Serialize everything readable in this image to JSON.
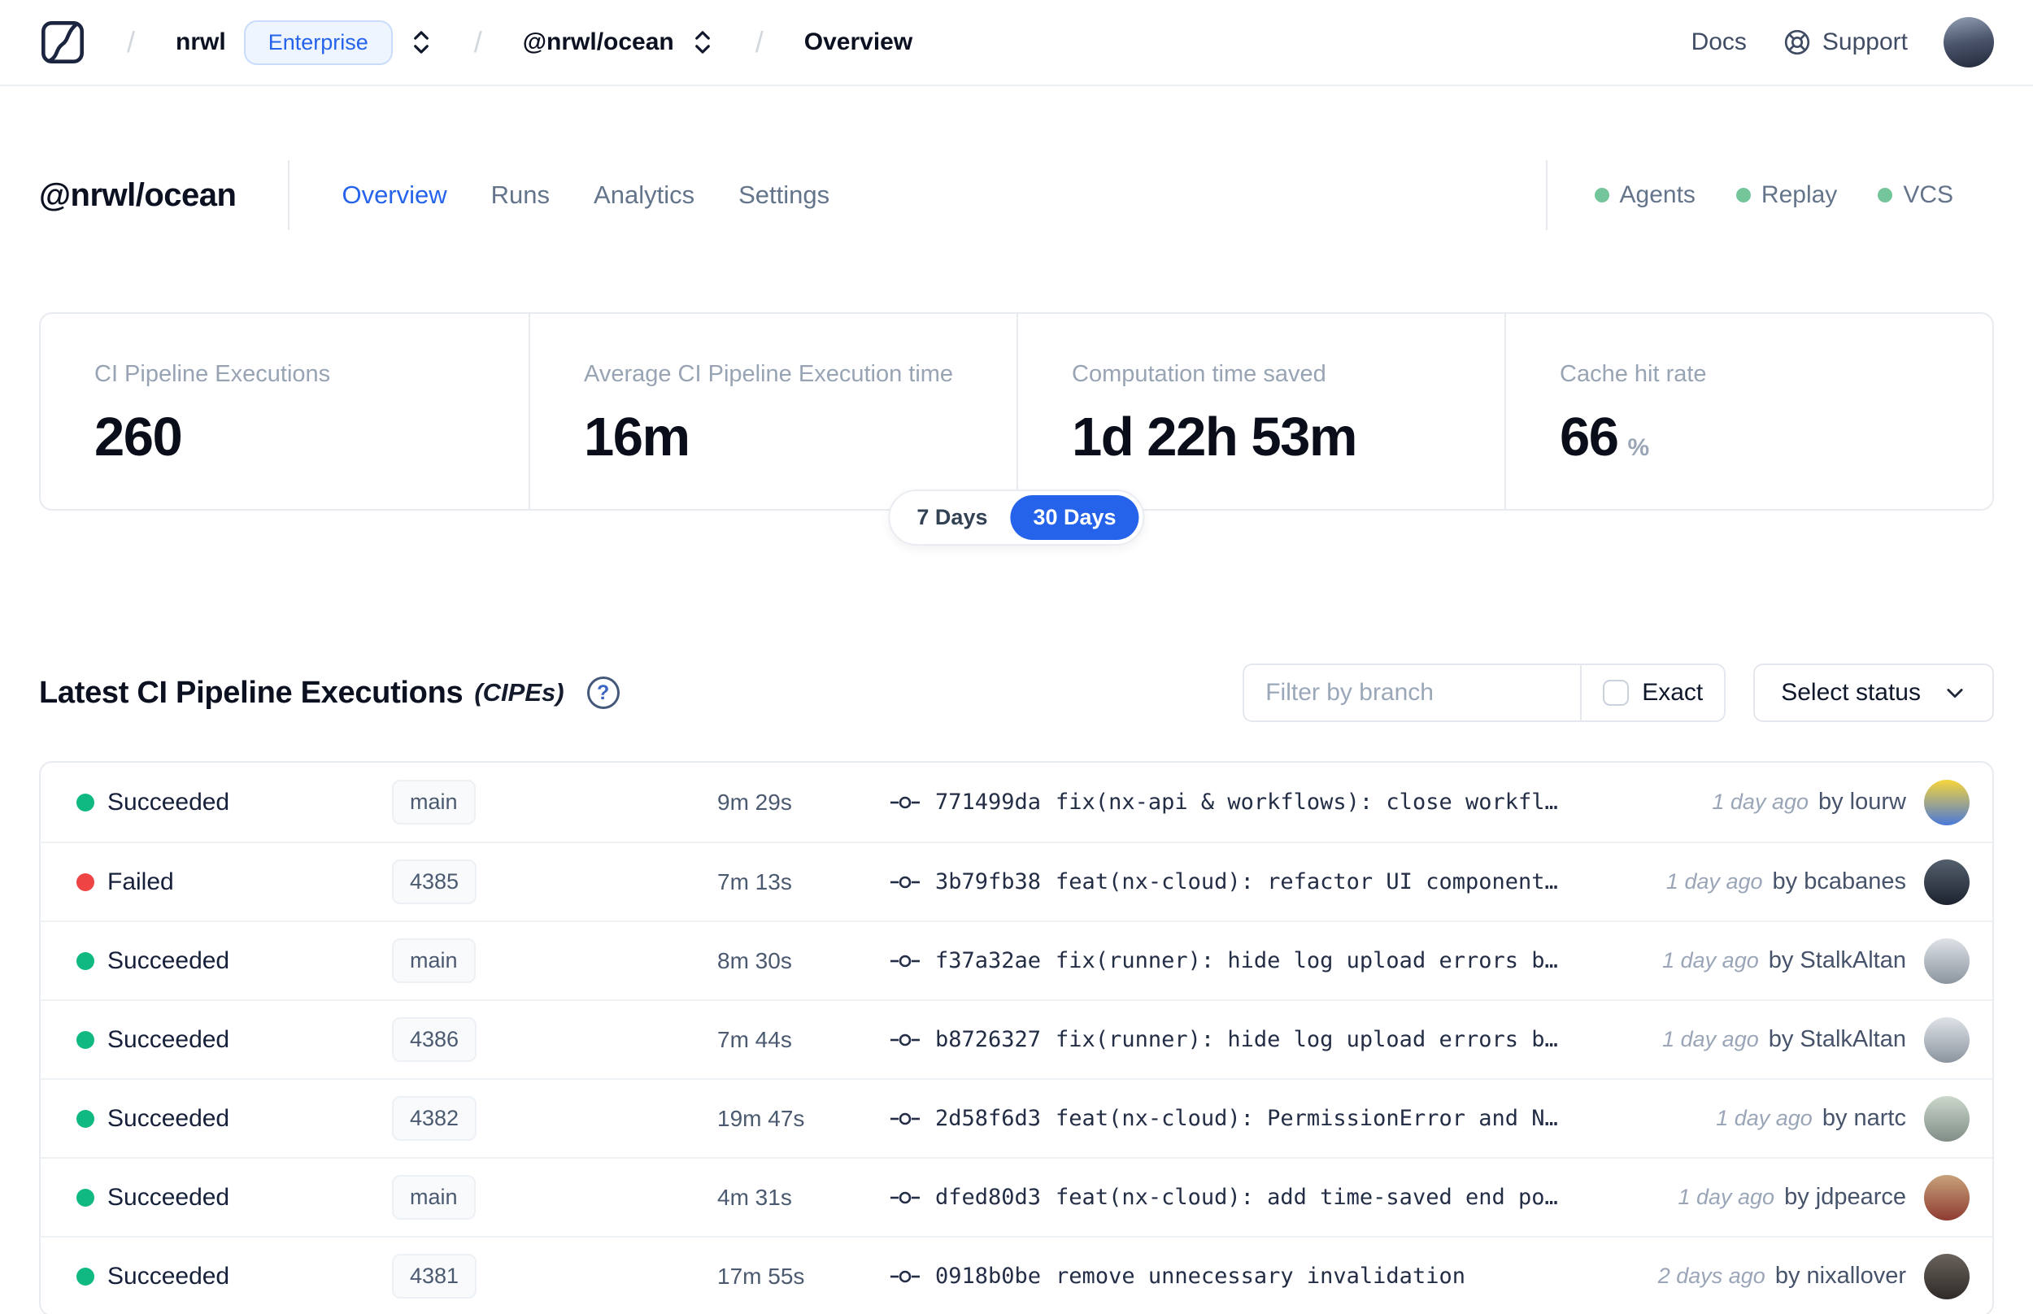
{
  "colors": {
    "accent": "#2563eb",
    "success": "#10b981",
    "failure": "#ef4444",
    "indicator_green": "#74c69a"
  },
  "icons": {
    "help": "?"
  },
  "navbar": {
    "separator": "/",
    "org": "nrwl",
    "org_badge": "Enterprise",
    "workspace": "@nrwl/ocean",
    "page": "Overview",
    "docs": "Docs",
    "support": "Support"
  },
  "header": {
    "title": "@nrwl/ocean",
    "tabs": [
      {
        "label": "Overview",
        "active": true
      },
      {
        "label": "Runs",
        "active": false
      },
      {
        "label": "Analytics",
        "active": false
      },
      {
        "label": "Settings",
        "active": false
      }
    ],
    "indicators": [
      {
        "label": "Agents"
      },
      {
        "label": "Replay"
      },
      {
        "label": "VCS"
      }
    ]
  },
  "stats": [
    {
      "label": "CI Pipeline Executions",
      "value": "260",
      "suffix": ""
    },
    {
      "label": "Average CI Pipeline Execution time",
      "value": "16m",
      "suffix": ""
    },
    {
      "label": "Computation time saved",
      "value": "1d 22h 53m",
      "suffix": ""
    },
    {
      "label": "Cache hit rate",
      "value": "66",
      "suffix": "%"
    }
  ],
  "range_toggle": [
    {
      "label": "7 Days",
      "active": false
    },
    {
      "label": "30 Days",
      "active": true
    }
  ],
  "section": {
    "title": "Latest CI Pipeline Executions",
    "subtitle": "(CIPEs)"
  },
  "filters": {
    "branch_placeholder": "Filter by branch",
    "exact_label": "Exact",
    "status_label": "Select status"
  },
  "table": {
    "rows": [
      {
        "status": "Succeeded",
        "branch": "main",
        "duration": "9m 29s",
        "hash": "771499da",
        "message": "fix(nx-api & workflows): close workfl…",
        "ago": "1 day ago",
        "author": "by lourw",
        "avatar": [
          "#f7d53b",
          "#4a79d9"
        ]
      },
      {
        "status": "Failed",
        "branch": "4385",
        "duration": "7m 13s",
        "hash": "3b79fb38",
        "message": "feat(nx-cloud): refactor UI component…",
        "ago": "1 day ago",
        "author": "by bcabanes",
        "avatar": [
          "#55606e",
          "#1d232e"
        ]
      },
      {
        "status": "Succeeded",
        "branch": "main",
        "duration": "8m 30s",
        "hash": "f37a32ae",
        "message": "fix(runner): hide log upload errors b…",
        "ago": "1 day ago",
        "author": "by StalkAltan",
        "avatar": [
          "#dfe3e8",
          "#8b949e"
        ]
      },
      {
        "status": "Succeeded",
        "branch": "4386",
        "duration": "7m 44s",
        "hash": "b8726327",
        "message": "fix(runner): hide log upload errors b…",
        "ago": "1 day ago",
        "author": "by StalkAltan",
        "avatar": [
          "#dfe3e8",
          "#8b949e"
        ]
      },
      {
        "status": "Succeeded",
        "branch": "4382",
        "duration": "19m 47s",
        "hash": "2d58f6d3",
        "message": "feat(nx-cloud): PermissionError and N…",
        "ago": "1 day ago",
        "author": "by nartc",
        "avatar": [
          "#cdd8cc",
          "#7f8d86"
        ]
      },
      {
        "status": "Succeeded",
        "branch": "main",
        "duration": "4m 31s",
        "hash": "dfed80d3",
        "message": "feat(nx-cloud): add time-saved end po…",
        "ago": "1 day ago",
        "author": "by jdpearce",
        "avatar": [
          "#c8a27a",
          "#8e3b32"
        ]
      },
      {
        "status": "Succeeded",
        "branch": "4381",
        "duration": "17m 55s",
        "hash": "0918b0be",
        "message": "remove unnecessary invalidation",
        "ago": "2 days ago",
        "author": "by nixallover",
        "avatar": [
          "#6a625c",
          "#2f2b28"
        ]
      }
    ]
  }
}
